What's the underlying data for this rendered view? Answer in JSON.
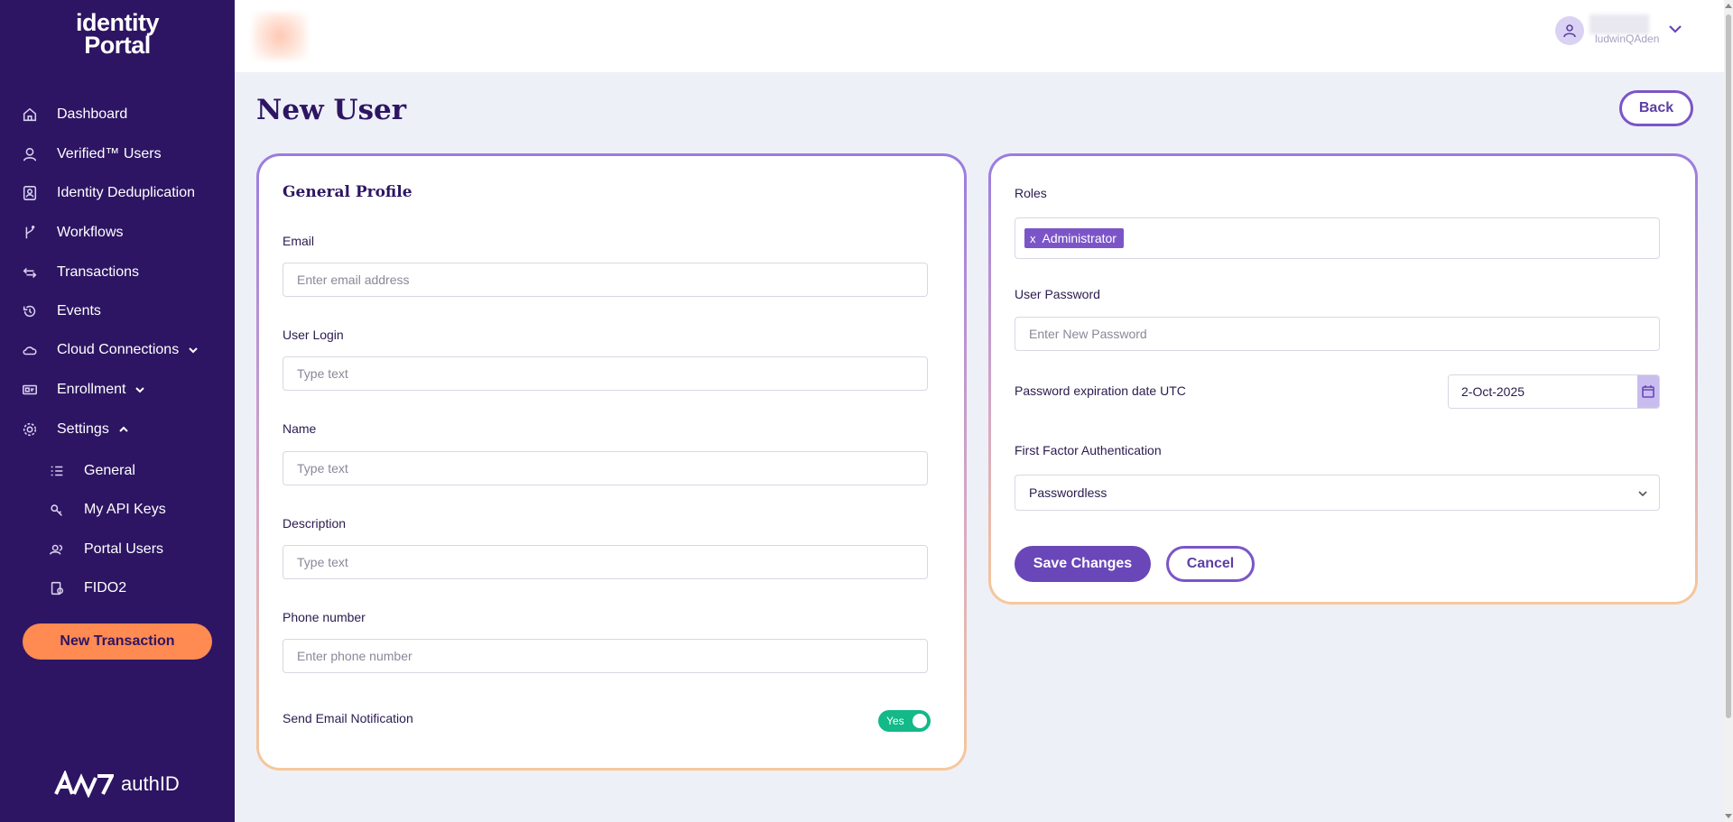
{
  "app": {
    "logo_line1": "identity",
    "logo_line2": "Portal",
    "brand_text": "authID"
  },
  "sidebar": {
    "items": [
      {
        "label": "Dashboard",
        "icon": "home-icon"
      },
      {
        "label": "Verified™ Users",
        "icon": "user-icon"
      },
      {
        "label": "Identity Deduplication",
        "icon": "id-card-icon"
      },
      {
        "label": "Workflows",
        "icon": "branch-icon"
      },
      {
        "label": "Transactions",
        "icon": "arrows-icon"
      },
      {
        "label": "Events",
        "icon": "history-icon"
      },
      {
        "label": "Cloud Connections",
        "icon": "cloud-icon"
      },
      {
        "label": "Enrollment",
        "icon": "device-icon"
      },
      {
        "label": "Settings",
        "icon": "gear-icon"
      }
    ],
    "settings_sub": [
      {
        "label": "General",
        "icon": "list-icon"
      },
      {
        "label": "My API Keys",
        "icon": "key-icon"
      },
      {
        "label": "Portal Users",
        "icon": "users-icon"
      },
      {
        "label": "FIDO2",
        "icon": "fido-icon"
      }
    ],
    "new_transaction": "New Transaction"
  },
  "header": {
    "user_name": "ludwinQAden"
  },
  "page": {
    "title": "New User",
    "back": "Back"
  },
  "general_profile": {
    "title": "General Profile",
    "email_label": "Email",
    "email_placeholder": "Enter email address",
    "login_label": "User Login",
    "login_placeholder": "Type text",
    "name_label": "Name",
    "name_placeholder": "Type text",
    "description_label": "Description",
    "description_placeholder": "Type text",
    "phone_label": "Phone number",
    "phone_placeholder": "Enter phone number",
    "notify_label": "Send Email Notification",
    "notify_value": "Yes"
  },
  "access": {
    "roles_label": "Roles",
    "roles": [
      "Administrator"
    ],
    "password_label": "User Password",
    "password_placeholder": "Enter New Password",
    "expiration_label": "Password expiration date UTC",
    "expiration_value": "2-Oct-2025",
    "ffa_label": "First Factor Authentication",
    "ffa_value": "Passwordless",
    "save": "Save Changes",
    "cancel": "Cancel"
  },
  "colors": {
    "sidebar_bg": "#2d1563",
    "accent": "#6a47b8",
    "orange": "#ff8a52",
    "toggle_on": "#13b988"
  }
}
